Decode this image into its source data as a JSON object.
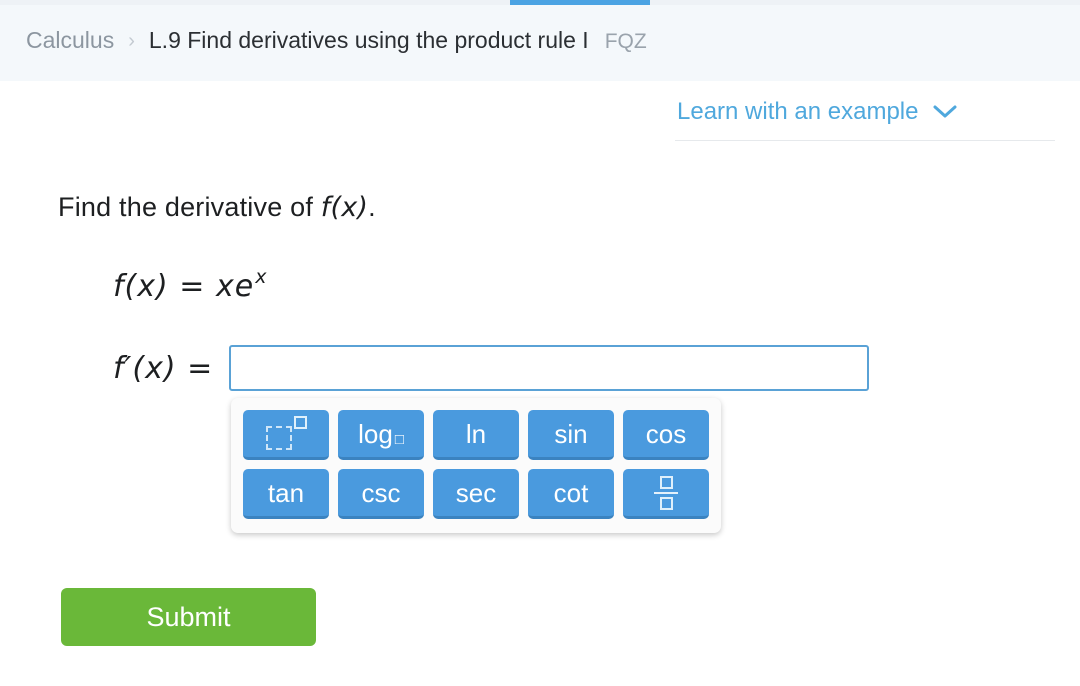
{
  "progress": {
    "name": "lesson-progress-bar",
    "fill_percent": 13
  },
  "header": {
    "subject": "Calculus",
    "separator": "›",
    "skill": "L.9 Find derivatives using the product rule I",
    "code": "FQZ"
  },
  "learn": {
    "label": "Learn with an example",
    "chevron": "chevron-down-icon"
  },
  "question": {
    "prompt_before": "Find the derivative of ",
    "prompt_math": "f(x)",
    "prompt_after": ".",
    "equation": {
      "lhs": "f(x)",
      "operator": "=",
      "rhs_base": "xe",
      "rhs_exponent": "x"
    },
    "answer": {
      "label_fn": "f′(x)",
      "label_op": "=",
      "value": "",
      "placeholder": ""
    }
  },
  "keypad": {
    "rows": [
      [
        {
          "label": "",
          "icon": "exponent-icon",
          "name": "key-exponent"
        },
        {
          "label": "log",
          "sub": "□",
          "icon": "",
          "name": "key-log"
        },
        {
          "label": "ln",
          "sub": "",
          "icon": "",
          "name": "key-ln"
        },
        {
          "label": "sin",
          "sub": "",
          "icon": "",
          "name": "key-sin"
        },
        {
          "label": "cos",
          "sub": "",
          "icon": "",
          "name": "key-cos"
        }
      ],
      [
        {
          "label": "tan",
          "sub": "",
          "icon": "",
          "name": "key-tan"
        },
        {
          "label": "csc",
          "sub": "",
          "icon": "",
          "name": "key-csc"
        },
        {
          "label": "sec",
          "sub": "",
          "icon": "",
          "name": "key-sec"
        },
        {
          "label": "cot",
          "sub": "",
          "icon": "",
          "name": "key-cot"
        },
        {
          "label": "",
          "icon": "fraction-icon",
          "name": "key-fraction"
        }
      ]
    ]
  },
  "submit": {
    "label": "Submit"
  },
  "colors": {
    "accent_blue": "#4a9ade",
    "link_blue": "#4fa8dd",
    "input_border": "#5aa2d6",
    "submit_green": "#6ab839",
    "header_bg": "#f4f8fb",
    "progress_fill": "#4ba3e3"
  }
}
